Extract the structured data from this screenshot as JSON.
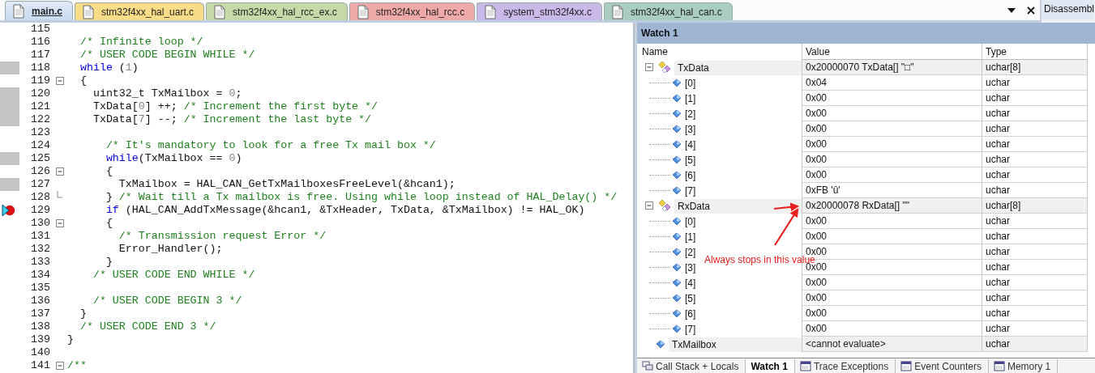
{
  "file_tabs": [
    {
      "label": "main.c",
      "selected": true,
      "color": "#c9daf0"
    },
    {
      "label": "stm32f4xx_hal_uart.c",
      "selected": false,
      "color": "#f8dc88"
    },
    {
      "label": "stm32f4xx_hal_rcc_ex.c",
      "selected": false,
      "color": "#c6d9a9"
    },
    {
      "label": "stm32f4xx_hal_rcc.c",
      "selected": false,
      "color": "#f0a9a9"
    },
    {
      "label": "system_stm32f4xx.c",
      "selected": false,
      "color": "#c9b9e9"
    },
    {
      "label": "stm32f4xx_hal_can.c",
      "selected": false,
      "color": "#a9cdbf"
    }
  ],
  "side_panel_tab": {
    "label": "Disassembl"
  },
  "editor": {
    "lines": [
      {
        "number": "115"
      },
      {
        "number": "116",
        "parts": [
          {
            "kind": "comment",
            "text": "  /* Infinite loop */"
          }
        ]
      },
      {
        "number": "117",
        "parts": [
          {
            "kind": "comment",
            "text": "  /* USER CODE BEGIN WHILE */"
          }
        ]
      },
      {
        "number": "118",
        "executed": true,
        "parts": [
          {
            "kind": "keyword",
            "text": "  while"
          },
          {
            "kind": "plain",
            "text": " ("
          },
          {
            "kind": "number",
            "text": "1"
          },
          {
            "kind": "plain",
            "text": ")"
          }
        ]
      },
      {
        "number": "119",
        "foldable": true,
        "parts": [
          {
            "kind": "plain",
            "text": "  {"
          }
        ]
      },
      {
        "number": "120",
        "executed": true,
        "parts": [
          {
            "kind": "plain",
            "text": "    uint32_t TxMailbox = "
          },
          {
            "kind": "number",
            "text": "0"
          },
          {
            "kind": "plain",
            "text": ";"
          }
        ]
      },
      {
        "number": "121",
        "executed": true,
        "parts": [
          {
            "kind": "plain",
            "text": "    TxData["
          },
          {
            "kind": "number",
            "text": "0"
          },
          {
            "kind": "plain",
            "text": "] ++; "
          },
          {
            "kind": "comment",
            "text": "/* Increment the first byte */"
          }
        ]
      },
      {
        "number": "122",
        "executed": true,
        "parts": [
          {
            "kind": "plain",
            "text": "    TxData["
          },
          {
            "kind": "number",
            "text": "7"
          },
          {
            "kind": "plain",
            "text": "] --; "
          },
          {
            "kind": "comment",
            "text": "/* Increment the last byte */"
          }
        ]
      },
      {
        "number": "123"
      },
      {
        "number": "124",
        "parts": [
          {
            "kind": "comment",
            "text": "      /* It's mandatory to look for a free Tx mail box */"
          }
        ]
      },
      {
        "number": "125",
        "executed": true,
        "parts": [
          {
            "kind": "keyword",
            "text": "      while"
          },
          {
            "kind": "plain",
            "text": "(TxMailbox == "
          },
          {
            "kind": "number",
            "text": "0"
          },
          {
            "kind": "plain",
            "text": ")"
          }
        ]
      },
      {
        "number": "126",
        "foldable": true,
        "parts": [
          {
            "kind": "plain",
            "text": "      {"
          }
        ]
      },
      {
        "number": "127",
        "executed": true,
        "parts": [
          {
            "kind": "plain",
            "text": "        TxMailbox = HAL_CAN_GetTxMailboxesFreeLevel(&hcan1);"
          }
        ]
      },
      {
        "number": "128",
        "fold_end": true,
        "parts": [
          {
            "kind": "plain",
            "text": "      } "
          },
          {
            "kind": "comment",
            "text": "/* Wait till a Tx mailbox is free. Using while loop instead of HAL_Delay() */"
          }
        ]
      },
      {
        "number": "129",
        "breakpoint": true,
        "current": true,
        "parts": [
          {
            "kind": "keyword",
            "text": "      if"
          },
          {
            "kind": "plain",
            "text": " (HAL_CAN_AddTxMessage(&hcan1, &TxHeader, TxData, &TxMailbox) != HAL_OK)"
          }
        ]
      },
      {
        "number": "130",
        "foldable": true,
        "parts": [
          {
            "kind": "plain",
            "text": "      {"
          }
        ]
      },
      {
        "number": "131",
        "parts": [
          {
            "kind": "comment",
            "text": "        /* Transmission request Error */"
          }
        ]
      },
      {
        "number": "132",
        "parts": [
          {
            "kind": "plain",
            "text": "        Error_Handler();"
          }
        ]
      },
      {
        "number": "133",
        "parts": [
          {
            "kind": "plain",
            "text": "      }"
          }
        ]
      },
      {
        "number": "134",
        "parts": [
          {
            "kind": "comment",
            "text": "    /* USER CODE END WHILE */"
          }
        ]
      },
      {
        "number": "135"
      },
      {
        "number": "136",
        "parts": [
          {
            "kind": "comment",
            "text": "    /* USER CODE BEGIN 3 */"
          }
        ]
      },
      {
        "number": "137",
        "parts": [
          {
            "kind": "plain",
            "text": "  }"
          }
        ]
      },
      {
        "number": "138",
        "parts": [
          {
            "kind": "comment",
            "text": "  /* USER CODE END 3 */"
          }
        ]
      },
      {
        "number": "139",
        "parts": [
          {
            "kind": "plain",
            "text": "}"
          }
        ]
      },
      {
        "number": "140"
      },
      {
        "number": "141",
        "foldable": true,
        "parts": [
          {
            "kind": "comment",
            "text": "/**"
          }
        ]
      }
    ]
  },
  "watch": {
    "title": "Watch 1",
    "columns": [
      "Name",
      "Value",
      "Type"
    ],
    "rows": [
      {
        "name": "TxData",
        "value": "0x20000070 TxData[] \"□\"",
        "type": "uchar[8]",
        "expanded": true,
        "children": [
          {
            "name": "[0]",
            "value": "0x04",
            "type": "uchar"
          },
          {
            "name": "[1]",
            "value": "0x00",
            "type": "uchar"
          },
          {
            "name": "[2]",
            "value": "0x00",
            "type": "uchar"
          },
          {
            "name": "[3]",
            "value": "0x00",
            "type": "uchar"
          },
          {
            "name": "[4]",
            "value": "0x00",
            "type": "uchar"
          },
          {
            "name": "[5]",
            "value": "0x00",
            "type": "uchar"
          },
          {
            "name": "[6]",
            "value": "0x00",
            "type": "uchar"
          },
          {
            "name": "[7]",
            "value": "0xFB 'û'",
            "type": "uchar"
          }
        ]
      },
      {
        "name": "RxData",
        "value": "0x20000078 RxData[] \"\"",
        "type": "uchar[8]",
        "expanded": true,
        "children": [
          {
            "name": "[0]",
            "value": "0x00",
            "type": "uchar"
          },
          {
            "name": "[1]",
            "value": "0x00",
            "type": "uchar"
          },
          {
            "name": "[2]",
            "value": "0x00",
            "type": "uchar"
          },
          {
            "name": "[3]",
            "value": "0x00",
            "type": "uchar"
          },
          {
            "name": "[4]",
            "value": "0x00",
            "type": "uchar"
          },
          {
            "name": "[5]",
            "value": "0x00",
            "type": "uchar"
          },
          {
            "name": "[6]",
            "value": "0x00",
            "type": "uchar"
          },
          {
            "name": "[7]",
            "value": "0x00",
            "type": "uchar"
          }
        ]
      },
      {
        "name": "TxMailbox",
        "value": "<cannot evaluate>",
        "type": "uchar",
        "unavailable": true
      }
    ],
    "annotation": {
      "text": "Always stops in this value"
    }
  },
  "bottom_tabs": [
    {
      "label": "Call Stack + Locals",
      "selected": false
    },
    {
      "label": "Watch 1",
      "selected": true
    },
    {
      "label": "Trace Exceptions",
      "selected": false
    },
    {
      "label": "Event Counters",
      "selected": false
    },
    {
      "label": "Memory 1",
      "selected": false
    }
  ]
}
